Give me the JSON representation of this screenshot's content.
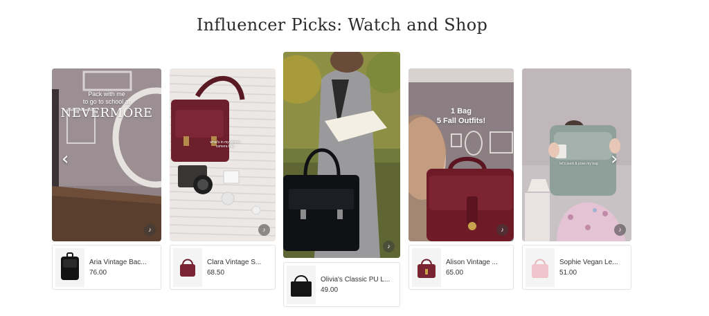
{
  "section": {
    "title": "Influencer Picks: Watch and Shop"
  },
  "cards": [
    {
      "overlay": [
        "Pack with me",
        "to go to school at",
        "NEVERMORE"
      ],
      "product": {
        "name": "Aria Vintage Bac...",
        "price": "76.00"
      }
    },
    {
      "caption": "what's in my school camera bag",
      "product": {
        "name": "Clara Vintage S...",
        "price": "68.50"
      }
    },
    {
      "product": {
        "name": "Olivia's Classic PU L...",
        "price": "49.00"
      }
    },
    {
      "overlay": [
        "1 Bag",
        "5 Fall Outfits!"
      ],
      "product": {
        "name": "Alison Vintage ...",
        "price": "65.00"
      }
    },
    {
      "caption": "let's pack & pose my bag",
      "product": {
        "name": "Sophie Vegan Le...",
        "price": "51.00"
      }
    }
  ],
  "icons": {
    "mute": "speaker-icon",
    "prev": "chevron-left-icon",
    "next": "chevron-right-icon"
  }
}
